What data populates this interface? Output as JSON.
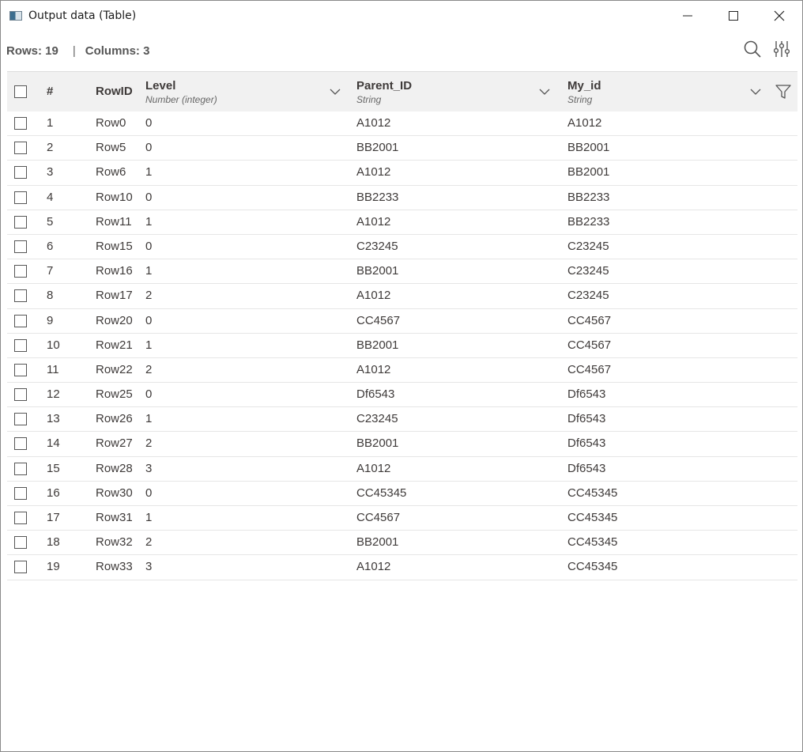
{
  "window": {
    "title": "Output data (Table)",
    "icon": "table-window-icon",
    "controls": [
      "minimize-icon",
      "maximize-icon",
      "close-icon"
    ]
  },
  "info": {
    "rows_label": "Rows: 19",
    "separator": "|",
    "columns_label": "Columns: 3",
    "icons": [
      "search-icon",
      "column-settings-icon"
    ]
  },
  "table": {
    "headers": {
      "num": "#",
      "rowid": "RowID",
      "level": {
        "name": "Level",
        "type": "Number (integer)"
      },
      "parent": {
        "name": "Parent_ID",
        "type": "String"
      },
      "myid": {
        "name": "My_id",
        "type": "String"
      }
    },
    "rows": [
      [
        "1",
        "Row0",
        "0",
        "A1012",
        "A1012"
      ],
      [
        "2",
        "Row5",
        "0",
        "BB2001",
        "BB2001"
      ],
      [
        "3",
        "Row6",
        "1",
        "A1012",
        "BB2001"
      ],
      [
        "4",
        "Row10",
        "0",
        "BB2233",
        "BB2233"
      ],
      [
        "5",
        "Row11",
        "1",
        "A1012",
        "BB2233"
      ],
      [
        "6",
        "Row15",
        "0",
        "C23245",
        "C23245"
      ],
      [
        "7",
        "Row16",
        "1",
        "BB2001",
        "C23245"
      ],
      [
        "8",
        "Row17",
        "2",
        "A1012",
        "C23245"
      ],
      [
        "9",
        "Row20",
        "0",
        "CC4567",
        "CC4567"
      ],
      [
        "10",
        "Row21",
        "1",
        "BB2001",
        "CC4567"
      ],
      [
        "11",
        "Row22",
        "2",
        "A1012",
        "CC4567"
      ],
      [
        "12",
        "Row25",
        "0",
        "Df6543",
        "Df6543"
      ],
      [
        "13",
        "Row26",
        "1",
        "C23245",
        "Df6543"
      ],
      [
        "14",
        "Row27",
        "2",
        "BB2001",
        "Df6543"
      ],
      [
        "15",
        "Row28",
        "3",
        "A1012",
        "Df6543"
      ],
      [
        "16",
        "Row30",
        "0",
        "CC45345",
        "CC45345"
      ],
      [
        "17",
        "Row31",
        "1",
        "CC4567",
        "CC45345"
      ],
      [
        "18",
        "Row32",
        "2",
        "BB2001",
        "CC45345"
      ],
      [
        "19",
        "Row33",
        "3",
        "A1012",
        "CC45345"
      ]
    ]
  }
}
